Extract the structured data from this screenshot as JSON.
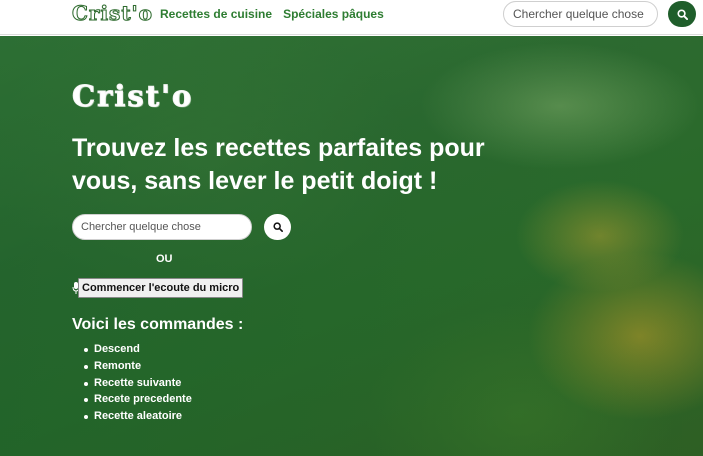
{
  "navbar": {
    "brand": "Crist'o",
    "links": [
      "Recettes de cuisine",
      "Spéciales pâques"
    ],
    "search_placeholder": "Chercher quelque chose",
    "search_button_icon": "search-icon"
  },
  "hero": {
    "brand": "Crist'o",
    "title": "Trouvez les recettes parfaites pour vous, sans lever le petit doigt !",
    "search_placeholder": "Chercher quelque chose",
    "search_button_icon": "search-icon",
    "or_text": "OU",
    "mic_icon": "microphone-icon",
    "mic_button_label": "Commencer l'ecoute du micro",
    "commands_title": "Voici les commandes :",
    "commands": [
      "Descend",
      "Remonte",
      "Recette suivante",
      "Recete precedente",
      "Recette aleatoire"
    ]
  },
  "colors": {
    "brand_green": "#2e7d32",
    "button_dark_green": "#1f5e2b",
    "hero_text": "#ffffff"
  }
}
